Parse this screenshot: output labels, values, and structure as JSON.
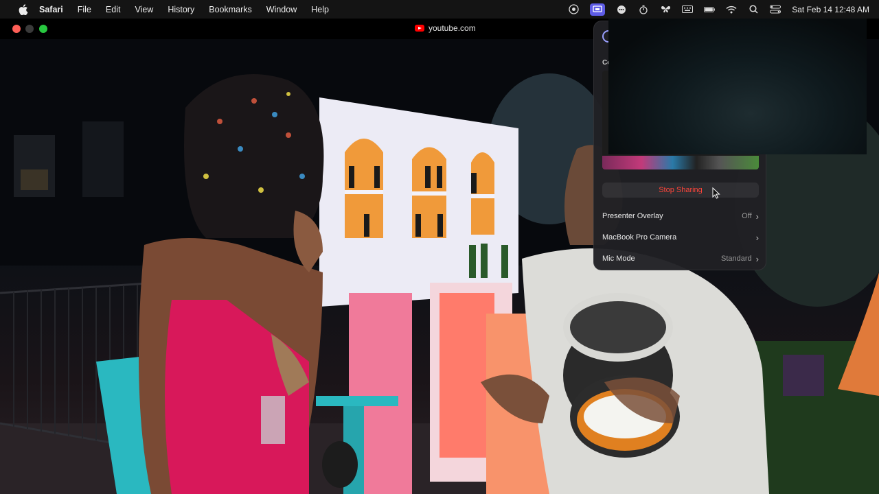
{
  "menubar": {
    "apple_icon": "apple-logo-icon",
    "app_name": "Safari",
    "items": [
      "File",
      "Edit",
      "View",
      "History",
      "Bookmarks",
      "Window",
      "Help"
    ],
    "clock": "Sat Feb 14  12:48 AM",
    "status_icons": [
      "eye-tracking-icon",
      "screen-sharing-icon",
      "chat-bubble-icon",
      "stopwatch-icon",
      "butterfly-icon",
      "keyboard-icon",
      "battery-icon",
      "wifi-icon",
      "search-icon",
      "control-center-icon"
    ]
  },
  "window": {
    "url": "youtube.com",
    "favicon": "youtube-icon"
  },
  "panel": {
    "heading_initial": "Co",
    "stop_label": "Stop Sharing",
    "rows": [
      {
        "label": "Presenter Overlay",
        "value": "Off"
      },
      {
        "label": "MacBook Pro Camera",
        "value": ""
      },
      {
        "label": "Mic Mode",
        "value": "Standard"
      }
    ],
    "stop_color": "#ff453a",
    "accent": "#5e5ce6"
  }
}
